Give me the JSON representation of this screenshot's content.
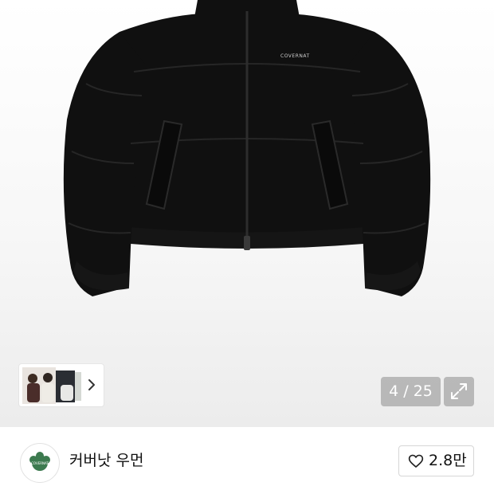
{
  "gallery": {
    "counter": "4 / 25",
    "thumbnail_icon": "chevron-right-icon",
    "expand_icon": "expand-arrows-icon",
    "jacket_label": "COVERNAT"
  },
  "store": {
    "name": "커버낫 우먼",
    "logo_text": "COVERNAT",
    "logo_color": "#3c7a4f"
  },
  "like": {
    "icon": "heart-outline-icon",
    "count": "2.8만"
  }
}
